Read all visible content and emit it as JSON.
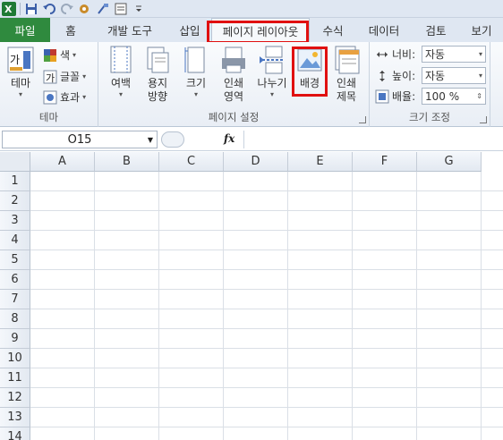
{
  "tabs": [
    {
      "label": "파일"
    },
    {
      "label": "홈"
    },
    {
      "label": "개발 도구"
    },
    {
      "label": "삽입"
    },
    {
      "label": "페이지 레이아웃"
    },
    {
      "label": "수식"
    },
    {
      "label": "데이터"
    },
    {
      "label": "검토"
    },
    {
      "label": "보기"
    }
  ],
  "ribbon": {
    "theme_group": {
      "label": "테마",
      "theme_button": "테마",
      "colors": "색",
      "fonts": "글꼴",
      "effects": "효과"
    },
    "page_setup_group": {
      "label": "페이지 설정",
      "margins": "여백",
      "orientation_1": "용지",
      "orientation_2": "방향",
      "size": "크기",
      "print_area_1": "인쇄",
      "print_area_2": "영역",
      "breaks": "나누기",
      "background": "배경",
      "print_titles_1": "인쇄",
      "print_titles_2": "제목"
    },
    "scale_group": {
      "label": "크기 조정",
      "width_label": "너비:",
      "width_value": "자동",
      "height_label": "높이:",
      "height_value": "자동",
      "scale_label": "배율:",
      "scale_value": "100 %"
    }
  },
  "formula_bar": {
    "name_box": "O15",
    "fx": "fx",
    "content": ""
  },
  "grid": {
    "columns": [
      "A",
      "B",
      "C",
      "D",
      "E",
      "F",
      "G"
    ],
    "rows": [
      "1",
      "2",
      "3",
      "4",
      "5",
      "6",
      "7",
      "8",
      "9",
      "10",
      "11",
      "12",
      "13",
      "14"
    ]
  },
  "colors": {
    "file_tab": "#2f8a3e",
    "highlight": "#e01010"
  }
}
